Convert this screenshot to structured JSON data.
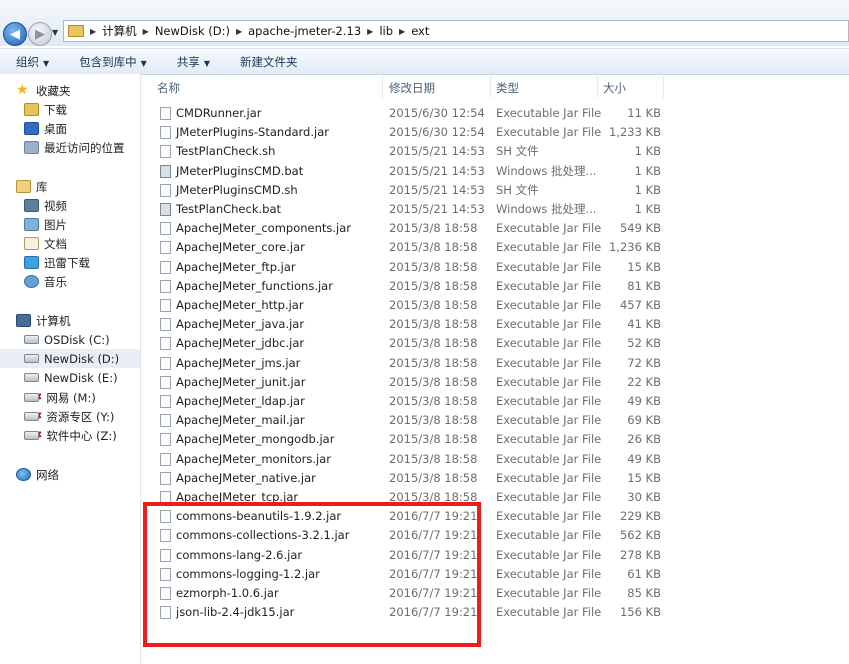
{
  "address_bar": {
    "breadcrumb": [
      "计算机",
      "NewDisk (D:)",
      "apache-jmeter-2.13",
      "lib",
      "ext"
    ]
  },
  "toolbar": {
    "organize": "组织",
    "include_in_library": "包含到库中",
    "share": "共享",
    "new_folder": "新建文件夹"
  },
  "nav": {
    "favorites": "收藏夹",
    "favorites_items": [
      "下载",
      "桌面",
      "最近访问的位置"
    ],
    "libraries": "库",
    "library_items": [
      "视频",
      "图片",
      "文档",
      "迅雷下载",
      "音乐"
    ],
    "computer": "计算机",
    "drives": [
      "OSDisk (C:)",
      "NewDisk (D:)",
      "NewDisk (E:)"
    ],
    "network_drives": [
      "网易 (M:)",
      "资源专区 (Y:)",
      "软件中心 (Z:)"
    ],
    "network": "网络",
    "selected": "NewDisk (D:)"
  },
  "columns": {
    "name": "名称",
    "date": "修改日期",
    "type": "类型",
    "size": "大小"
  },
  "files": [
    {
      "name": "CMDRunner.jar",
      "date": "2015/6/30 12:54",
      "type": "Executable Jar File",
      "size": "11 KB",
      "icon": "jar-file-icon"
    },
    {
      "name": "JMeterPlugins-Standard.jar",
      "date": "2015/6/30 12:54",
      "type": "Executable Jar File",
      "size": "1,233 KB",
      "icon": "jar-file-icon"
    },
    {
      "name": "TestPlanCheck.sh",
      "date": "2015/5/21 14:53",
      "type": "SH 文件",
      "size": "1 KB",
      "icon": "sh-file-icon"
    },
    {
      "name": "JMeterPluginsCMD.bat",
      "date": "2015/5/21 14:53",
      "type": "Windows 批处理...",
      "size": "1 KB",
      "icon": "bat-file-icon"
    },
    {
      "name": "JMeterPluginsCMD.sh",
      "date": "2015/5/21 14:53",
      "type": "SH 文件",
      "size": "1 KB",
      "icon": "sh-file-icon"
    },
    {
      "name": "TestPlanCheck.bat",
      "date": "2015/5/21 14:53",
      "type": "Windows 批处理...",
      "size": "1 KB",
      "icon": "bat-file-icon"
    },
    {
      "name": "ApacheJMeter_components.jar",
      "date": "2015/3/8 18:58",
      "type": "Executable Jar File",
      "size": "549 KB",
      "icon": "jar-file-icon"
    },
    {
      "name": "ApacheJMeter_core.jar",
      "date": "2015/3/8 18:58",
      "type": "Executable Jar File",
      "size": "1,236 KB",
      "icon": "jar-file-icon"
    },
    {
      "name": "ApacheJMeter_ftp.jar",
      "date": "2015/3/8 18:58",
      "type": "Executable Jar File",
      "size": "15 KB",
      "icon": "jar-file-icon"
    },
    {
      "name": "ApacheJMeter_functions.jar",
      "date": "2015/3/8 18:58",
      "type": "Executable Jar File",
      "size": "81 KB",
      "icon": "jar-file-icon"
    },
    {
      "name": "ApacheJMeter_http.jar",
      "date": "2015/3/8 18:58",
      "type": "Executable Jar File",
      "size": "457 KB",
      "icon": "jar-file-icon"
    },
    {
      "name": "ApacheJMeter_java.jar",
      "date": "2015/3/8 18:58",
      "type": "Executable Jar File",
      "size": "41 KB",
      "icon": "jar-file-icon"
    },
    {
      "name": "ApacheJMeter_jdbc.jar",
      "date": "2015/3/8 18:58",
      "type": "Executable Jar File",
      "size": "52 KB",
      "icon": "jar-file-icon"
    },
    {
      "name": "ApacheJMeter_jms.jar",
      "date": "2015/3/8 18:58",
      "type": "Executable Jar File",
      "size": "72 KB",
      "icon": "jar-file-icon"
    },
    {
      "name": "ApacheJMeter_junit.jar",
      "date": "2015/3/8 18:58",
      "type": "Executable Jar File",
      "size": "22 KB",
      "icon": "jar-file-icon"
    },
    {
      "name": "ApacheJMeter_ldap.jar",
      "date": "2015/3/8 18:58",
      "type": "Executable Jar File",
      "size": "49 KB",
      "icon": "jar-file-icon"
    },
    {
      "name": "ApacheJMeter_mail.jar",
      "date": "2015/3/8 18:58",
      "type": "Executable Jar File",
      "size": "69 KB",
      "icon": "jar-file-icon"
    },
    {
      "name": "ApacheJMeter_mongodb.jar",
      "date": "2015/3/8 18:58",
      "type": "Executable Jar File",
      "size": "26 KB",
      "icon": "jar-file-icon"
    },
    {
      "name": "ApacheJMeter_monitors.jar",
      "date": "2015/3/8 18:58",
      "type": "Executable Jar File",
      "size": "49 KB",
      "icon": "jar-file-icon"
    },
    {
      "name": "ApacheJMeter_native.jar",
      "date": "2015/3/8 18:58",
      "type": "Executable Jar File",
      "size": "15 KB",
      "icon": "jar-file-icon"
    },
    {
      "name": "ApacheJMeter_tcp.jar",
      "date": "2015/3/8 18:58",
      "type": "Executable Jar File",
      "size": "30 KB",
      "icon": "jar-file-icon"
    },
    {
      "name": "commons-beanutils-1.9.2.jar",
      "date": "2016/7/7 19:21",
      "type": "Executable Jar File",
      "size": "229 KB",
      "icon": "jar-file-icon"
    },
    {
      "name": "commons-collections-3.2.1.jar",
      "date": "2016/7/7 19:21",
      "type": "Executable Jar File",
      "size": "562 KB",
      "icon": "jar-file-icon"
    },
    {
      "name": "commons-lang-2.6.jar",
      "date": "2016/7/7 19:21",
      "type": "Executable Jar File",
      "size": "278 KB",
      "icon": "jar-file-icon"
    },
    {
      "name": "commons-logging-1.2.jar",
      "date": "2016/7/7 19:21",
      "type": "Executable Jar File",
      "size": "61 KB",
      "icon": "jar-file-icon"
    },
    {
      "name": "ezmorph-1.0.6.jar",
      "date": "2016/7/7 19:21",
      "type": "Executable Jar File",
      "size": "85 KB",
      "icon": "jar-file-icon"
    },
    {
      "name": "json-lib-2.4-jdk15.jar",
      "date": "2016/7/7 19:21",
      "type": "Executable Jar File",
      "size": "156 KB",
      "icon": "jar-file-icon"
    }
  ],
  "highlight_color": "#ee1c1c"
}
